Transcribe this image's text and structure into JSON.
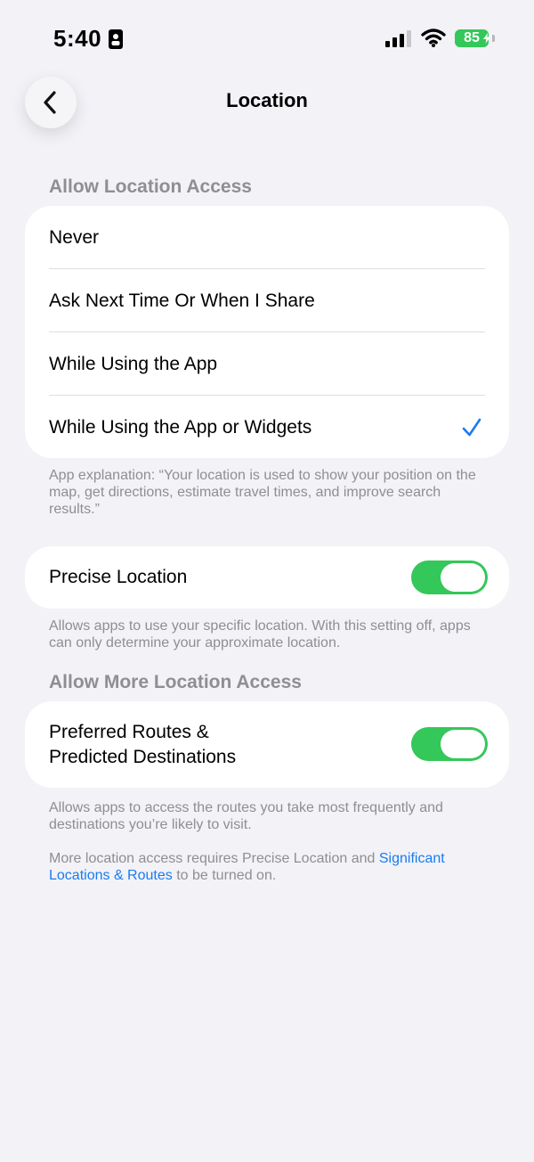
{
  "status_bar": {
    "time": "5:40",
    "battery_percent": "85",
    "battery_charging": true,
    "signal_bars": 3,
    "wifi": true
  },
  "nav": {
    "title": "Location",
    "back_icon": "chevron-left-icon"
  },
  "allow_access": {
    "header": "Allow Location Access",
    "options": [
      {
        "label": "Never",
        "selected": false
      },
      {
        "label": "Ask Next Time Or When I Share",
        "selected": false
      },
      {
        "label": "While Using the App",
        "selected": false
      },
      {
        "label": "While Using the App or Widgets",
        "selected": true
      }
    ],
    "explanation": "App explanation: “Your location is used to show your position on the map, get directions, estimate travel times, and improve search results.”"
  },
  "precise_location": {
    "label": "Precise Location",
    "enabled": true,
    "footnote": "Allows apps to use your specific location. With this setting off, apps can only determine your approximate location."
  },
  "more_access": {
    "header": "Allow More Location Access",
    "routes_label_line1": "Preferred Routes &",
    "routes_label_line2": "Predicted Destinations",
    "routes_enabled": true,
    "footnote": "Allows apps to access the routes you take most frequently and destinations you’re likely to visit.",
    "requirement_prefix": "More location access requires Precise Location and ",
    "requirement_link": "Significant Locations & Routes",
    "requirement_suffix": " to be turned on."
  },
  "colors": {
    "accent": "#1a7cf0",
    "toggle_on": "#34c759",
    "background": "#f2f2f7",
    "secondary_text": "#8e8e93"
  }
}
